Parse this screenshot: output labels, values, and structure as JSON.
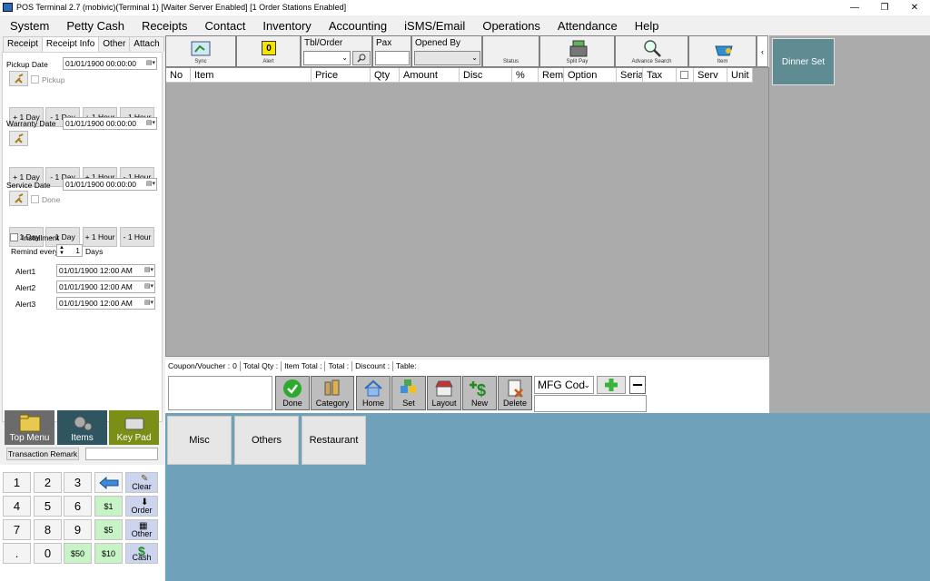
{
  "window": {
    "title": "POS Terminal 2.7 (mobivic)(Terminal 1) [Waiter Server Enabled] [1 Order Stations Enabled]",
    "minimize": "—",
    "maximize": "❐",
    "close": "✕"
  },
  "menu": [
    "System",
    "Petty Cash",
    "Receipts",
    "Contact",
    "Inventory",
    "Accounting",
    "iSMS/Email",
    "Operations",
    "Attendance",
    "Help"
  ],
  "left_tabs": [
    "Receipt",
    "Receipt Info",
    "Other",
    "Attach"
  ],
  "receipt_info": {
    "pickup_date_label": "Pickup Date",
    "pickup_date": "01/01/1900 00:00:00",
    "pickup_check_label": "Pickup",
    "warranty_date_label": "Warranty Date",
    "warranty_date": "01/01/1900 00:00:00",
    "service_date_label": "Service Date",
    "service_date": "01/01/1900 00:00:00",
    "done_label": "Done",
    "day_buttons": [
      "+ 1 Day",
      "- 1 Day",
      "+ 1 Hour",
      "- 1 Hour"
    ],
    "installment_label": "Installment",
    "remind_every_label": "Remind every",
    "remind_value": "1",
    "days_label": "Days",
    "alerts": [
      {
        "label": "Alert1",
        "value": "01/01/1900 12:00 AM"
      },
      {
        "label": "Alert2",
        "value": "01/01/1900 12:00 AM"
      },
      {
        "label": "Alert3",
        "value": "01/01/1900 12:00 AM"
      }
    ]
  },
  "big_buttons": {
    "top_menu": "Top Menu",
    "items": "Items",
    "key_pad": "Key Pad"
  },
  "transaction_remark_label": "Transaction Remark",
  "keypad": {
    "row1": [
      "1",
      "2",
      "3"
    ],
    "row2": [
      "4",
      "5",
      "6"
    ],
    "row3": [
      "7",
      "8",
      "9"
    ],
    "row4": [
      ".",
      "0"
    ],
    "money": [
      "$1",
      "$5",
      "$50",
      "$10"
    ],
    "actions": [
      "Clear",
      "Order",
      "Other",
      "Cash"
    ]
  },
  "toolbar": {
    "sync": "Sync",
    "alert_count": "0",
    "alert": "Alert",
    "tbl_order": "Tbl/Order",
    "pax": "Pax",
    "opened_by": "Opened By",
    "status": "Status",
    "split_pay": "Split Pay",
    "advance_search": "Advance Search",
    "item": "Item",
    "collapse": "‹"
  },
  "grid_headers": [
    "No",
    "Item",
    "Price",
    "Qty",
    "Amount",
    "Disc",
    "%",
    "Rem",
    "Option",
    "Serial",
    "Tax",
    "",
    "Serv",
    "Unit"
  ],
  "dinner_set": "Dinner Set",
  "summary": {
    "coupon_label": "Coupon/Voucher :",
    "coupon_value": "0",
    "total_qty_label": "Total Qty :",
    "item_total_label": "Item Total :",
    "total_label": "Total :",
    "discount_label": "Discount :",
    "table_label": "Table:"
  },
  "actions": [
    "Done",
    "Category",
    "Home",
    "Set",
    "Layout",
    "New",
    "Delete"
  ],
  "mfg_select": "MFG Cod",
  "categories": [
    "Misc",
    "Others",
    "Restaurant"
  ],
  "colors": {
    "grid_bg": "#ababab",
    "category_bg": "#6fa1bb",
    "dinner_set": "#5f8b92",
    "alert_yellow": "#f5e400"
  }
}
